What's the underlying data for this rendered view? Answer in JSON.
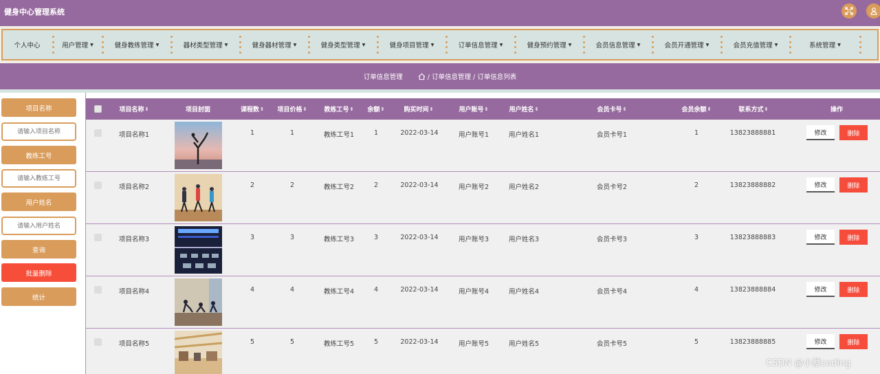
{
  "header": {
    "title": "健身中心管理系统"
  },
  "nav": [
    {
      "label": "个人中心"
    },
    {
      "label": "用户管理"
    },
    {
      "label": "健身教练管理"
    },
    {
      "label": "器材类型管理"
    },
    {
      "label": "健身器材管理"
    },
    {
      "label": "健身类型管理"
    },
    {
      "label": "健身项目管理"
    },
    {
      "label": "订单信息管理"
    },
    {
      "label": "健身预约管理"
    },
    {
      "label": "会员信息管理"
    },
    {
      "label": "会员开通管理"
    },
    {
      "label": "会员充值管理"
    },
    {
      "label": "系统管理"
    }
  ],
  "breadcrumb": {
    "section": "订单信息管理",
    "path": "/ 订单信息管理 / 订单信息列表"
  },
  "sidebar": {
    "project_label": "项目名称",
    "project_placeholder": "请输入项目名称",
    "coach_label": "教练工号",
    "coach_placeholder": "请输入教练工号",
    "user_label": "用户姓名",
    "user_placeholder": "请输入用户姓名",
    "query_button": "查询",
    "batch_delete_button": "批量删除",
    "stats_button": "统计"
  },
  "table": {
    "headers": {
      "name": "项目名称",
      "cover": "项目封面",
      "lessons": "课程数",
      "price": "项目价格",
      "coach": "教练工号",
      "remaining": "余额",
      "date": "购买时间",
      "account": "用户账号",
      "username": "用户姓名",
      "card": "会员卡号",
      "member_balance": "会员余额",
      "contact": "联系方式",
      "actions": "操作"
    },
    "sort_glyph": "⇕",
    "edit_label": "修改",
    "delete_label": "删除",
    "rows": [
      {
        "name": "项目名称1",
        "lessons": "1",
        "price": "1",
        "coach": "教练工号1",
        "remaining": "1",
        "date": "2022-03-14",
        "account": "用户账号1",
        "username": "用户姓名1",
        "card": "会员卡号1",
        "member_balance": "1",
        "contact": "13823888881",
        "thumb": "yoga-pose-sunset"
      },
      {
        "name": "项目名称2",
        "lessons": "2",
        "price": "2",
        "coach": "教练工号2",
        "remaining": "2",
        "date": "2022-03-14",
        "account": "用户账号2",
        "username": "用户姓名2",
        "card": "会员卡号2",
        "member_balance": "2",
        "contact": "13823888882",
        "thumb": "aerobics-class"
      },
      {
        "name": "项目名称3",
        "lessons": "3",
        "price": "3",
        "coach": "教练工号3",
        "remaining": "3",
        "date": "2022-03-14",
        "account": "用户账号3",
        "username": "用户姓名3",
        "card": "会员卡号3",
        "member_balance": "3",
        "contact": "13823888883",
        "thumb": "spin-studio"
      },
      {
        "name": "项目名称4",
        "lessons": "4",
        "price": "4",
        "coach": "教练工号4",
        "remaining": "4",
        "date": "2022-03-14",
        "account": "用户账号4",
        "username": "用户姓名4",
        "card": "会员卡号4",
        "member_balance": "4",
        "contact": "13823888884",
        "thumb": "yoga-class"
      },
      {
        "name": "项目名称5",
        "lessons": "5",
        "price": "5",
        "coach": "教练工号5",
        "remaining": "5",
        "date": "2022-03-14",
        "account": "用户账号5",
        "username": "用户姓名5",
        "card": "会员卡号5",
        "member_balance": "5",
        "contact": "13823888885",
        "thumb": "gym-hall"
      }
    ]
  },
  "watermark": "CSDN @小蔡coding",
  "colors": {
    "primary": "#966a9e",
    "accent": "#d99c5b",
    "danger": "#f54c3c",
    "nav_bg": "#d6e3e1"
  },
  "icons": {
    "fullscreen": "fullscreen-icon",
    "user": "user-icon",
    "home": "home-icon"
  }
}
